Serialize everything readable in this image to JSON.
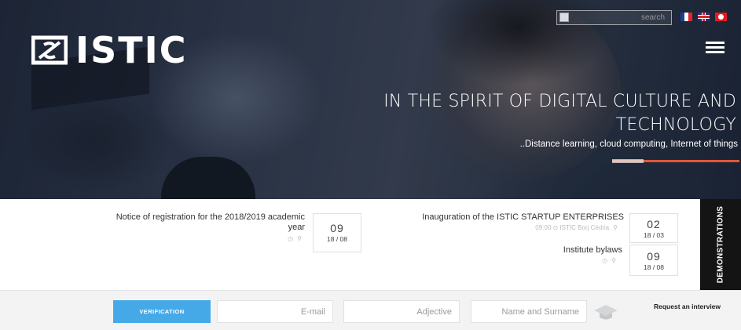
{
  "header": {
    "logo_text": "ISTIC",
    "search_placeholder": "search",
    "languages": [
      "fr",
      "en",
      "tn"
    ],
    "menu_icon": "hamburger-icon"
  },
  "hero": {
    "title_line1": "IN THE SPIRIT OF DIGITAL CULTURE AND",
    "title_line2": "TECHNOLOGY",
    "subtitle": "..Distance learning, cloud computing, Internet of things",
    "accent_color": "#e2563a"
  },
  "news": [
    {
      "title_line1": "Notice of registration for the 2018/2019 academic",
      "title_line2": "year",
      "day": "09",
      "date": "18 / 08"
    },
    {
      "title_line1": "Inauguration of the ISTIC STARTUP ENTERPRISES",
      "meta": "09:00 ⊙ ISTIC Borj Cédria",
      "day": "02",
      "date": "18 / 03"
    },
    {
      "title_line1": "Institute bylaws",
      "day": "09",
      "date": "18 / 08"
    }
  ],
  "demonstrations_label": "DEMONSTRATIONS",
  "form": {
    "verify_label": "VERIFICATION",
    "email_placeholder": "E-mail",
    "adjective_placeholder": "Adjective",
    "name_placeholder": "Name and Surname",
    "request_label": "Request an interview",
    "button_color": "#45a9e8"
  }
}
